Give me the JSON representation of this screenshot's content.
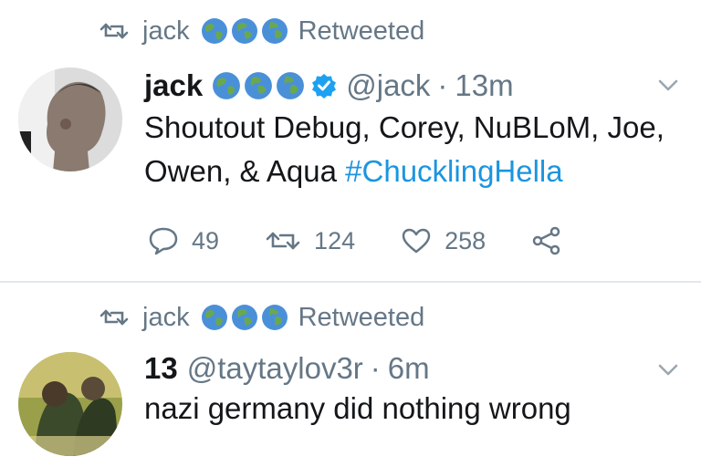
{
  "tweets": [
    {
      "retweeted_by": "jack",
      "retweeted_label": "Retweeted",
      "author_name": "jack",
      "author_handle": "@jack",
      "separator": "·",
      "time": "13m",
      "verified": true,
      "text": "Shoutout Debug, Corey, NuBLoM, Joe, Owen, & Aqua",
      "hashtag": "#ChucklingHella",
      "reply_count": "49",
      "retweet_count": "124",
      "like_count": "258"
    },
    {
      "retweeted_by": "jack",
      "retweeted_label": "Retweeted",
      "author_name": "13",
      "author_handle": "@taytaylov3r",
      "separator": "·",
      "time": "6m",
      "verified": false,
      "text": "nazi germany did nothing wrong"
    }
  ],
  "icons": {
    "retweet_indicator": "retweet-icon",
    "globe_emoji": "globe-emoji-icon",
    "verified": "verified-badge-icon",
    "menu": "chevron-down-icon",
    "reply": "reply-icon",
    "retweet": "retweet-icon",
    "like": "heart-icon",
    "share": "share-icon"
  },
  "colors": {
    "link": "#1b95e0",
    "muted": "#657786",
    "divider": "#e1e8ed",
    "verified": "#1da1f2"
  }
}
